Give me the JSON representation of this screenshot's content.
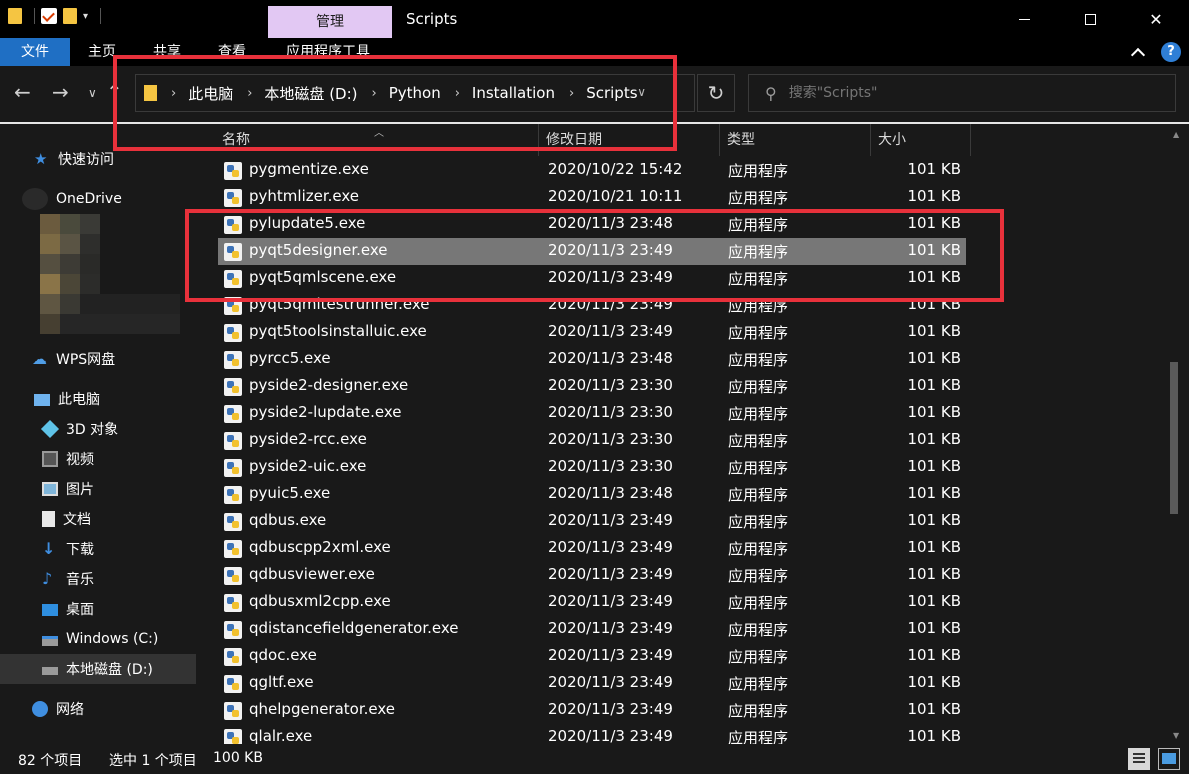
{
  "window": {
    "title": "Scripts",
    "manage_tab": "管理",
    "minimize_icon": "minimize-icon",
    "maximize_icon": "maximize-icon",
    "close_symbol": "✕"
  },
  "ribbon": {
    "tabs": [
      "文件",
      "主页",
      "共享",
      "查看",
      "应用程序工具"
    ],
    "help": "?"
  },
  "address": {
    "crumbs": [
      "此电脑",
      "本地磁盘 (D:)",
      "Python",
      "Installation",
      "Scripts"
    ],
    "search_placeholder": "搜索\"Scripts\""
  },
  "sidebar": {
    "items": [
      {
        "label": "快速访问",
        "icon": "star-icon"
      },
      {
        "label": "OneDrive",
        "icon": "cloud-icon"
      },
      {
        "label": "WPS网盘",
        "icon": "cloud-icon"
      },
      {
        "label": "此电脑",
        "icon": "computer-icon"
      },
      {
        "label": "3D 对象",
        "icon": "cube-icon"
      },
      {
        "label": "视频",
        "icon": "video-icon"
      },
      {
        "label": "图片",
        "icon": "picture-icon"
      },
      {
        "label": "文档",
        "icon": "document-icon"
      },
      {
        "label": "下载",
        "icon": "download-icon"
      },
      {
        "label": "音乐",
        "icon": "music-icon"
      },
      {
        "label": "桌面",
        "icon": "desktop-icon"
      },
      {
        "label": "Windows (C:)",
        "icon": "drive-icon"
      },
      {
        "label": "本地磁盘 (D:)",
        "icon": "drive-icon"
      },
      {
        "label": "网络",
        "icon": "network-icon"
      }
    ]
  },
  "columns": {
    "name": "名称",
    "date": "修改日期",
    "type": "类型",
    "size": "大小"
  },
  "files": [
    {
      "name": "pygmentize.exe",
      "date": "2020/10/22 15:42",
      "type": "应用程序",
      "size": "101 KB"
    },
    {
      "name": "pyhtmlizer.exe",
      "date": "2020/10/21 10:11",
      "type": "应用程序",
      "size": "101 KB"
    },
    {
      "name": "pylupdate5.exe",
      "date": "2020/11/3 23:48",
      "type": "应用程序",
      "size": "101 KB"
    },
    {
      "name": "pyqt5designer.exe",
      "date": "2020/11/3 23:49",
      "type": "应用程序",
      "size": "101 KB"
    },
    {
      "name": "pyqt5qmlscene.exe",
      "date": "2020/11/3 23:49",
      "type": "应用程序",
      "size": "101 KB"
    },
    {
      "name": "pyqt5qmltestrunner.exe",
      "date": "2020/11/3 23:49",
      "type": "应用程序",
      "size": "101 KB"
    },
    {
      "name": "pyqt5toolsinstalluic.exe",
      "date": "2020/11/3 23:49",
      "type": "应用程序",
      "size": "101 KB"
    },
    {
      "name": "pyrcc5.exe",
      "date": "2020/11/3 23:48",
      "type": "应用程序",
      "size": "101 KB"
    },
    {
      "name": "pyside2-designer.exe",
      "date": "2020/11/3 23:30",
      "type": "应用程序",
      "size": "101 KB"
    },
    {
      "name": "pyside2-lupdate.exe",
      "date": "2020/11/3 23:30",
      "type": "应用程序",
      "size": "101 KB"
    },
    {
      "name": "pyside2-rcc.exe",
      "date": "2020/11/3 23:30",
      "type": "应用程序",
      "size": "101 KB"
    },
    {
      "name": "pyside2-uic.exe",
      "date": "2020/11/3 23:30",
      "type": "应用程序",
      "size": "101 KB"
    },
    {
      "name": "pyuic5.exe",
      "date": "2020/11/3 23:48",
      "type": "应用程序",
      "size": "101 KB"
    },
    {
      "name": "qdbus.exe",
      "date": "2020/11/3 23:49",
      "type": "应用程序",
      "size": "101 KB"
    },
    {
      "name": "qdbuscpp2xml.exe",
      "date": "2020/11/3 23:49",
      "type": "应用程序",
      "size": "101 KB"
    },
    {
      "name": "qdbusviewer.exe",
      "date": "2020/11/3 23:49",
      "type": "应用程序",
      "size": "101 KB"
    },
    {
      "name": "qdbusxml2cpp.exe",
      "date": "2020/11/3 23:49",
      "type": "应用程序",
      "size": "101 KB"
    },
    {
      "name": "qdistancefieldgenerator.exe",
      "date": "2020/11/3 23:49",
      "type": "应用程序",
      "size": "101 KB"
    },
    {
      "name": "qdoc.exe",
      "date": "2020/11/3 23:49",
      "type": "应用程序",
      "size": "101 KB"
    },
    {
      "name": "qgltf.exe",
      "date": "2020/11/3 23:49",
      "type": "应用程序",
      "size": "101 KB"
    },
    {
      "name": "qhelpgenerator.exe",
      "date": "2020/11/3 23:49",
      "type": "应用程序",
      "size": "101 KB"
    },
    {
      "name": "qlalr.exe",
      "date": "2020/11/3 23:49",
      "type": "应用程序",
      "size": "101 KB"
    }
  ],
  "selected_index": 3,
  "status": {
    "count": "82 个项目",
    "selection": "选中 1 个项目",
    "selection_size": "100 KB"
  },
  "colors": {
    "background": "#191919",
    "accent": "#1f6fc4",
    "manage_tab": "#e2c8f3",
    "highlight_box": "#e8313b",
    "selected_row": "#777777"
  }
}
